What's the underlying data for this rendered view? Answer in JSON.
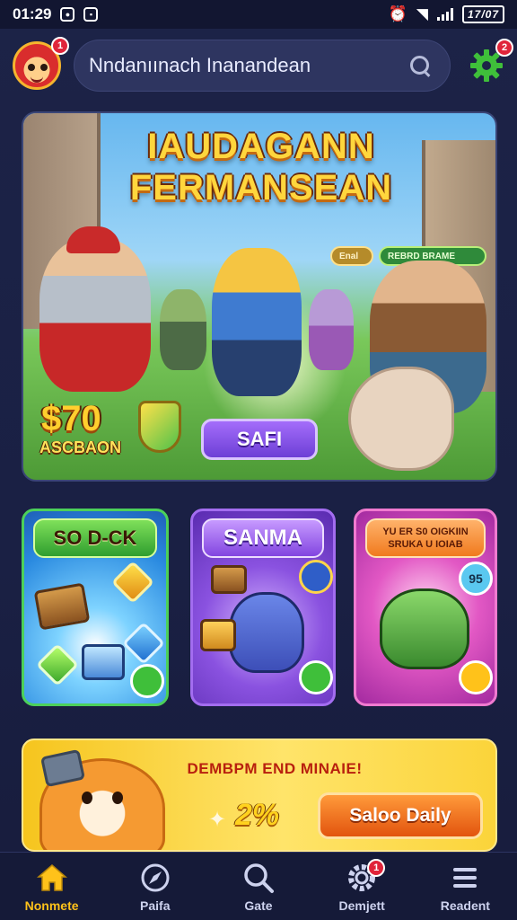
{
  "status_bar": {
    "time": "01:29",
    "battery": "17/07"
  },
  "header": {
    "avatar_badge": "1",
    "search_text": "Nndanıınach Inanandean",
    "settings_badge": "2"
  },
  "hero": {
    "title_line1": "IAUDAGANN",
    "title_line2": "FERMANSEAN",
    "chip_a": "Enal",
    "chip_b": "REBRD BRAME",
    "price": "$70",
    "price_subtitle": "ASCBAON",
    "button_label": "SAFI"
  },
  "cards": [
    {
      "label": "SO D-CK",
      "icon": "chest-icon",
      "coin": ""
    },
    {
      "label": "SANMA",
      "icon": "dragon-icon",
      "coin": ""
    },
    {
      "label": "YU ER S0 OIGKIIN SRUKA U IOIAB",
      "icon": "dragon-icon",
      "coin": "95"
    }
  ],
  "promo": {
    "title": "DEMBPM END MINAIE!",
    "percent": "2%",
    "button_label": "Saloo Daily"
  },
  "bottom_nav": [
    {
      "label": "Nonmete",
      "icon": "home-icon",
      "active": true,
      "badge": ""
    },
    {
      "label": "Paifa",
      "icon": "compass-icon",
      "active": false,
      "badge": ""
    },
    {
      "label": "Gate",
      "icon": "search-icon",
      "active": false,
      "badge": ""
    },
    {
      "label": "Demjett",
      "icon": "gear-icon",
      "active": false,
      "badge": "1"
    },
    {
      "label": "Readent",
      "icon": "menu-icon",
      "active": false,
      "badge": ""
    }
  ],
  "colors": {
    "background": "#1c2347",
    "accent_yellow": "#ffc21a",
    "badge_red": "#e0243a",
    "settings_green": "#3fbf3a"
  }
}
